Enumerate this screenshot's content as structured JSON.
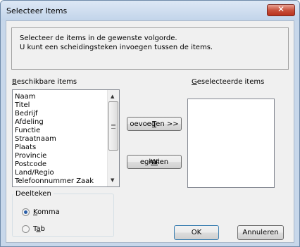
{
  "dialog": {
    "title": "Selecteer Items",
    "close_glyph": "✕",
    "instructions": [
      "Selecteer de items in de gewenste volgorde.",
      "U kunt een scheidingsteken invoegen tussen de items."
    ]
  },
  "available": {
    "label_accel": "B",
    "label_rest": "eschikbare items",
    "items": [
      "Naam",
      "Titel",
      "Bedrijf",
      "Afdeling",
      "Functie",
      "Straatnaam",
      "Plaats",
      "Provincie",
      "Postcode",
      "Land/Regio",
      "Telefoonnummer Zaak"
    ]
  },
  "selected": {
    "label_accel": "G",
    "label_rest": "eselecteerde items",
    "items": []
  },
  "buttons": {
    "add_accel": "T",
    "add_rest": "oevoegen >>",
    "remove_pre": "<< ",
    "remove_accel": "W",
    "remove_rest": "eghalen",
    "ok": "OK",
    "cancel": "Annuleren"
  },
  "separator": {
    "title": "Deelteken",
    "options": [
      {
        "accel": "K",
        "rest": "omma",
        "checked": true
      },
      {
        "pre": "T",
        "accel": "a",
        "rest": "b",
        "checked": false
      }
    ]
  },
  "icons": {
    "close": "close-icon",
    "scroll_up": "scroll-up-arrow-icon",
    "scroll_down": "scroll-down-arrow-icon"
  }
}
